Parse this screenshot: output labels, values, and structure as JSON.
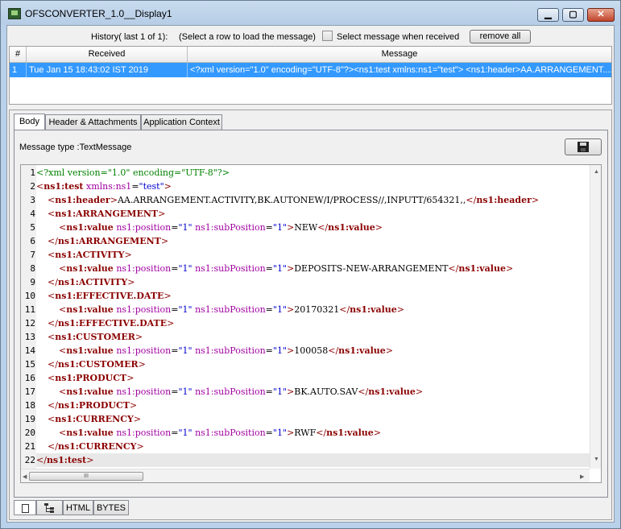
{
  "window": {
    "title": "OFSCONVERTER_1.0__Display1",
    "minimize_glyph": "▁",
    "maximize_glyph": "▢",
    "close_glyph": "✕"
  },
  "history": {
    "label": "History( last 1 of 1):",
    "hint": "(Select a row to load the message)",
    "checkbox_label": "Select message when received",
    "checkbox_checked": false,
    "remove_all_label": "remove all"
  },
  "table": {
    "columns": [
      "#",
      "Received",
      "Message"
    ],
    "rows": [
      {
        "num": "1",
        "received": "Tue Jan 15 18:43:02 IST 2019",
        "message": "<?xml version=\"1.0\" encoding=\"UTF-8\"?><ns1:test xmlns:ns1=\"test\">   <ns1:header>AA.ARRANGEMENT...."
      }
    ]
  },
  "tabs": [
    {
      "label": "Body",
      "active": true
    },
    {
      "label": "Header & Attachments",
      "active": false
    },
    {
      "label": "Application Context",
      "active": false
    }
  ],
  "message_type": "Message type :TextMessage",
  "editor": {
    "current_line": 22,
    "line_numbers": [
      "1",
      "2",
      "3",
      "4",
      "5",
      "6",
      "7",
      "8",
      "9",
      "10",
      "11",
      "12",
      "13",
      "14",
      "15",
      "16",
      "17",
      "18",
      "19",
      "20",
      "21",
      "22"
    ],
    "lines": [
      {
        "indent": "",
        "pi": "<?xml version=\"1.0\" encoding=\"UTF-8\"?>"
      },
      {
        "indent": "",
        "open": "ns1:test",
        "attrs": [
          {
            "name": "xmlns:ns1",
            "value": "\"test\""
          }
        ]
      },
      {
        "indent": "    ",
        "open": "ns1:header",
        "text": "AA.ARRANGEMENT.ACTIVITY,BK.AUTONEW/I/PROCESS//,INPUTT/654321,,",
        "close": "ns1:header"
      },
      {
        "indent": "    ",
        "open": "ns1:ARRANGEMENT"
      },
      {
        "indent": "        ",
        "open": "ns1:value",
        "attrs": [
          {
            "name": "ns1:position",
            "value": "\"1\""
          },
          {
            "name": "ns1:subPosition",
            "value": "\"1\""
          }
        ],
        "text": "NEW",
        "close": "ns1:value"
      },
      {
        "indent": "    ",
        "close": "ns1:ARRANGEMENT"
      },
      {
        "indent": "    ",
        "open": "ns1:ACTIVITY"
      },
      {
        "indent": "        ",
        "open": "ns1:value",
        "attrs": [
          {
            "name": "ns1:position",
            "value": "\"1\""
          },
          {
            "name": "ns1:subPosition",
            "value": "\"1\""
          }
        ],
        "text": "DEPOSITS-NEW-ARRANGEMENT",
        "close": "ns1:value"
      },
      {
        "indent": "    ",
        "close": "ns1:ACTIVITY"
      },
      {
        "indent": "    ",
        "open": "ns1:EFFECTIVE.DATE"
      },
      {
        "indent": "        ",
        "open": "ns1:value",
        "attrs": [
          {
            "name": "ns1:position",
            "value": "\"1\""
          },
          {
            "name": "ns1:subPosition",
            "value": "\"1\""
          }
        ],
        "text": "20170321",
        "close": "ns1:value"
      },
      {
        "indent": "    ",
        "close": "ns1:EFFECTIVE.DATE"
      },
      {
        "indent": "    ",
        "open": "ns1:CUSTOMER"
      },
      {
        "indent": "        ",
        "open": "ns1:value",
        "attrs": [
          {
            "name": "ns1:position",
            "value": "\"1\""
          },
          {
            "name": "ns1:subPosition",
            "value": "\"1\""
          }
        ],
        "text": "100058",
        "close": "ns1:value"
      },
      {
        "indent": "    ",
        "close": "ns1:CUSTOMER"
      },
      {
        "indent": "    ",
        "open": "ns1:PRODUCT"
      },
      {
        "indent": "        ",
        "open": "ns1:value",
        "attrs": [
          {
            "name": "ns1:position",
            "value": "\"1\""
          },
          {
            "name": "ns1:subPosition",
            "value": "\"1\""
          }
        ],
        "text": "BK.AUTO.SAV",
        "close": "ns1:value"
      },
      {
        "indent": "    ",
        "close": "ns1:PRODUCT"
      },
      {
        "indent": "    ",
        "open": "ns1:CURRENCY"
      },
      {
        "indent": "        ",
        "open": "ns1:value",
        "attrs": [
          {
            "name": "ns1:position",
            "value": "\"1\""
          },
          {
            "name": "ns1:subPosition",
            "value": "\"1\""
          }
        ],
        "text": "RWF",
        "close": "ns1:value"
      },
      {
        "indent": "    ",
        "close": "ns1:CURRENCY"
      },
      {
        "indent": "",
        "close": "ns1:test"
      }
    ]
  },
  "bottom_tabs": [
    {
      "icon": "document-icon",
      "label": "",
      "active": true
    },
    {
      "icon": "tree-icon",
      "label": "",
      "active": false
    },
    {
      "icon": "",
      "label": "HTML",
      "active": false
    },
    {
      "icon": "",
      "label": "BYTES",
      "active": false
    }
  ],
  "scroll_glyphs": {
    "up": "▲",
    "down": "▼",
    "left": "◀",
    "right": "▶",
    "grip": "III"
  }
}
